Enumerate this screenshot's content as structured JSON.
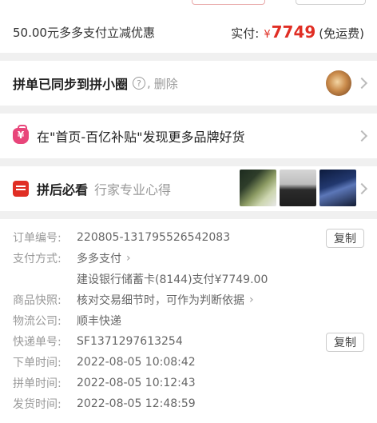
{
  "summary": {
    "promo_text": "50.00元多多支付立减优惠",
    "paid_label": "实付:",
    "currency": "¥",
    "paid_amount": "7749",
    "shipping_note": "(免运费)"
  },
  "sync": {
    "title": "拼单已同步到拼小圈",
    "help_icon": "?",
    "comma": ",",
    "delete_label": "删除"
  },
  "subsidy": {
    "text": "在\"首页-百亿补贴\"发现更多品牌好货"
  },
  "must_see": {
    "title": "拼后必看",
    "subtitle": "行家专业心得"
  },
  "order": {
    "copy_label": "复制",
    "rows": [
      {
        "key": "订单编号:",
        "value": "220805-131795526542083"
      },
      {
        "key": "支付方式:",
        "value": "多多支付"
      },
      {
        "key": "",
        "value": "建设银行储蓄卡(8144)支付¥7749.00"
      },
      {
        "key": "商品快照:",
        "value": "核对交易细节时，可作为判断依据"
      },
      {
        "key": "物流公司:",
        "value": "顺丰快递"
      },
      {
        "key": "快递单号:",
        "value": "SF1371297613254"
      },
      {
        "key": "下单时间:",
        "value": "2022-08-05 10:08:42"
      },
      {
        "key": "拼单时间:",
        "value": "2022-08-05 10:12:43"
      },
      {
        "key": "发货时间:",
        "value": "2022-08-05 12:48:59"
      }
    ]
  },
  "colors": {
    "accent": "#e02e24",
    "subsidy_icon": "#e8457a",
    "muted_text": "#999999"
  },
  "icons": [
    "help-circle-icon",
    "chevron-right-icon",
    "subsidy-bag-icon",
    "doc-list-icon"
  ]
}
